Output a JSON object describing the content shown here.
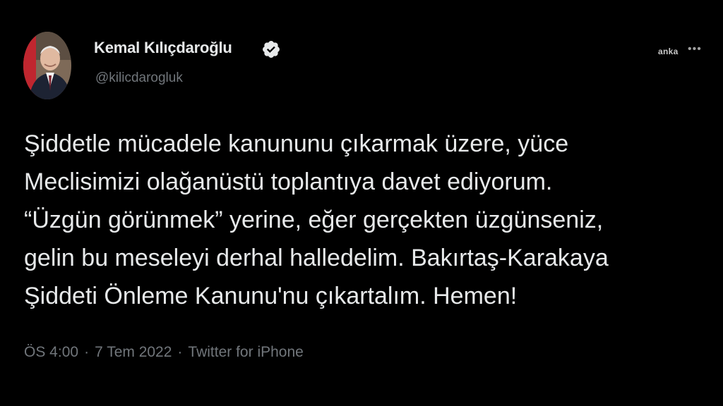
{
  "tweet": {
    "author": {
      "name": "Kemal Kılıçdaroğlu",
      "handle": "@kilicdarogluk",
      "verified": true
    },
    "watermark": "anka",
    "more_icon": "more-horizontal-icon",
    "text_lines": [
      "Şiddetle mücadele kanununu çıkarmak üzere, yüce",
      "Meclisimizi olağanüstü toplantıya davet ediyorum.",
      "“Üzgün görünmek” yerine, eğer gerçekten üzgünseniz,",
      "gelin bu meseleyi derhal halledelim. Bakırtaş-Karakaya",
      "Şiddeti Önleme Kanunu'nu çıkartalım. Hemen!"
    ],
    "meta": {
      "time": "ÖS 4:00",
      "separator": "·",
      "date": "7 Tem 2022",
      "source": "Twitter for iPhone"
    }
  },
  "colors": {
    "background": "#000000",
    "text": "#e7e9ea",
    "secondary_text": "#71767b",
    "verified_badge": "#e7e9ea"
  }
}
